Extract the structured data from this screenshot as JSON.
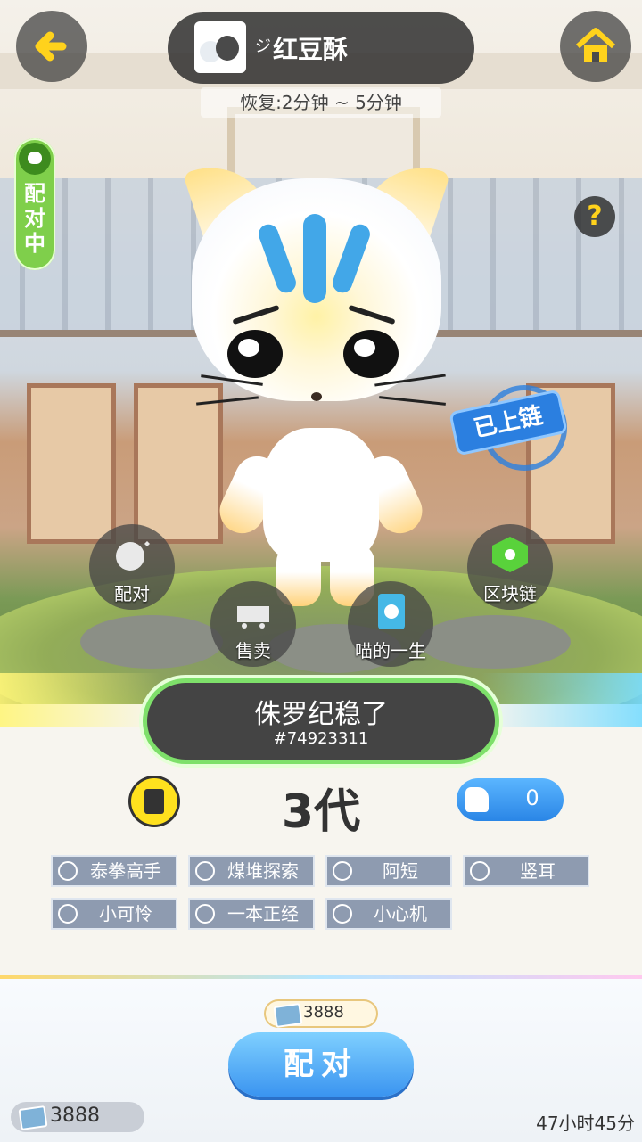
{
  "header": {
    "back": "back-arrow-icon",
    "home": "home-icon",
    "pet_owner_prefix": "ジ",
    "pet_owner": "红豆酥",
    "recovery_text": "恢复:2分钟 ~ 5分钟"
  },
  "status": {
    "label": "配对中"
  },
  "help": {
    "label": "?"
  },
  "chain_badge": {
    "label": "已上链"
  },
  "actions": [
    {
      "label": "配对",
      "icon": "cat-heart-icon"
    },
    {
      "label": "售卖",
      "icon": "shopping-cart-icon"
    },
    {
      "label": "喵的一生",
      "icon": "cat-book-icon"
    },
    {
      "label": "区块链",
      "icon": "blockchain-icon"
    }
  ],
  "pet": {
    "name": "侏罗纪稳了",
    "id": "#74923311",
    "generation": "3代",
    "likes": "0"
  },
  "traits": [
    {
      "label": "泰拳高手",
      "icon": "paw-icon"
    },
    {
      "label": "煤堆探索",
      "icon": "drop-icon"
    },
    {
      "label": "阿短",
      "icon": "tail-icon"
    },
    {
      "label": "竖耳",
      "icon": "ear-icon"
    },
    {
      "label": "小可怜",
      "icon": "eye-icon"
    },
    {
      "label": "一本正经",
      "icon": "mouth-icon"
    },
    {
      "label": "小心机",
      "icon": "whisker-icon"
    }
  ],
  "footer": {
    "cost": "3888",
    "pair_button": "配对",
    "balance": "3888",
    "timer": "47小时45分"
  },
  "colors": {
    "accent_blue": "#3a94f0",
    "status_green": "#7fcf4b",
    "icon_yellow": "#ffd21c"
  }
}
